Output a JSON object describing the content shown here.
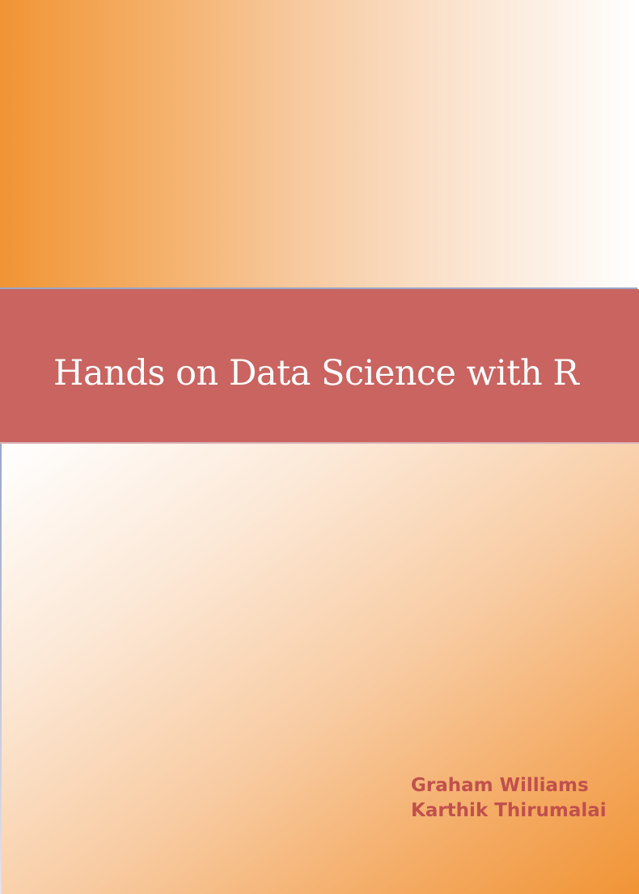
{
  "cover": {
    "title": "Hands on Data Science with R",
    "authors": [
      "Graham Williams",
      "Karthik Thirumalai"
    ]
  },
  "colors": {
    "band": "#c96461",
    "accent_orange": "#f19435",
    "author_text": "#c0504d",
    "title_text": "#ffffff"
  }
}
